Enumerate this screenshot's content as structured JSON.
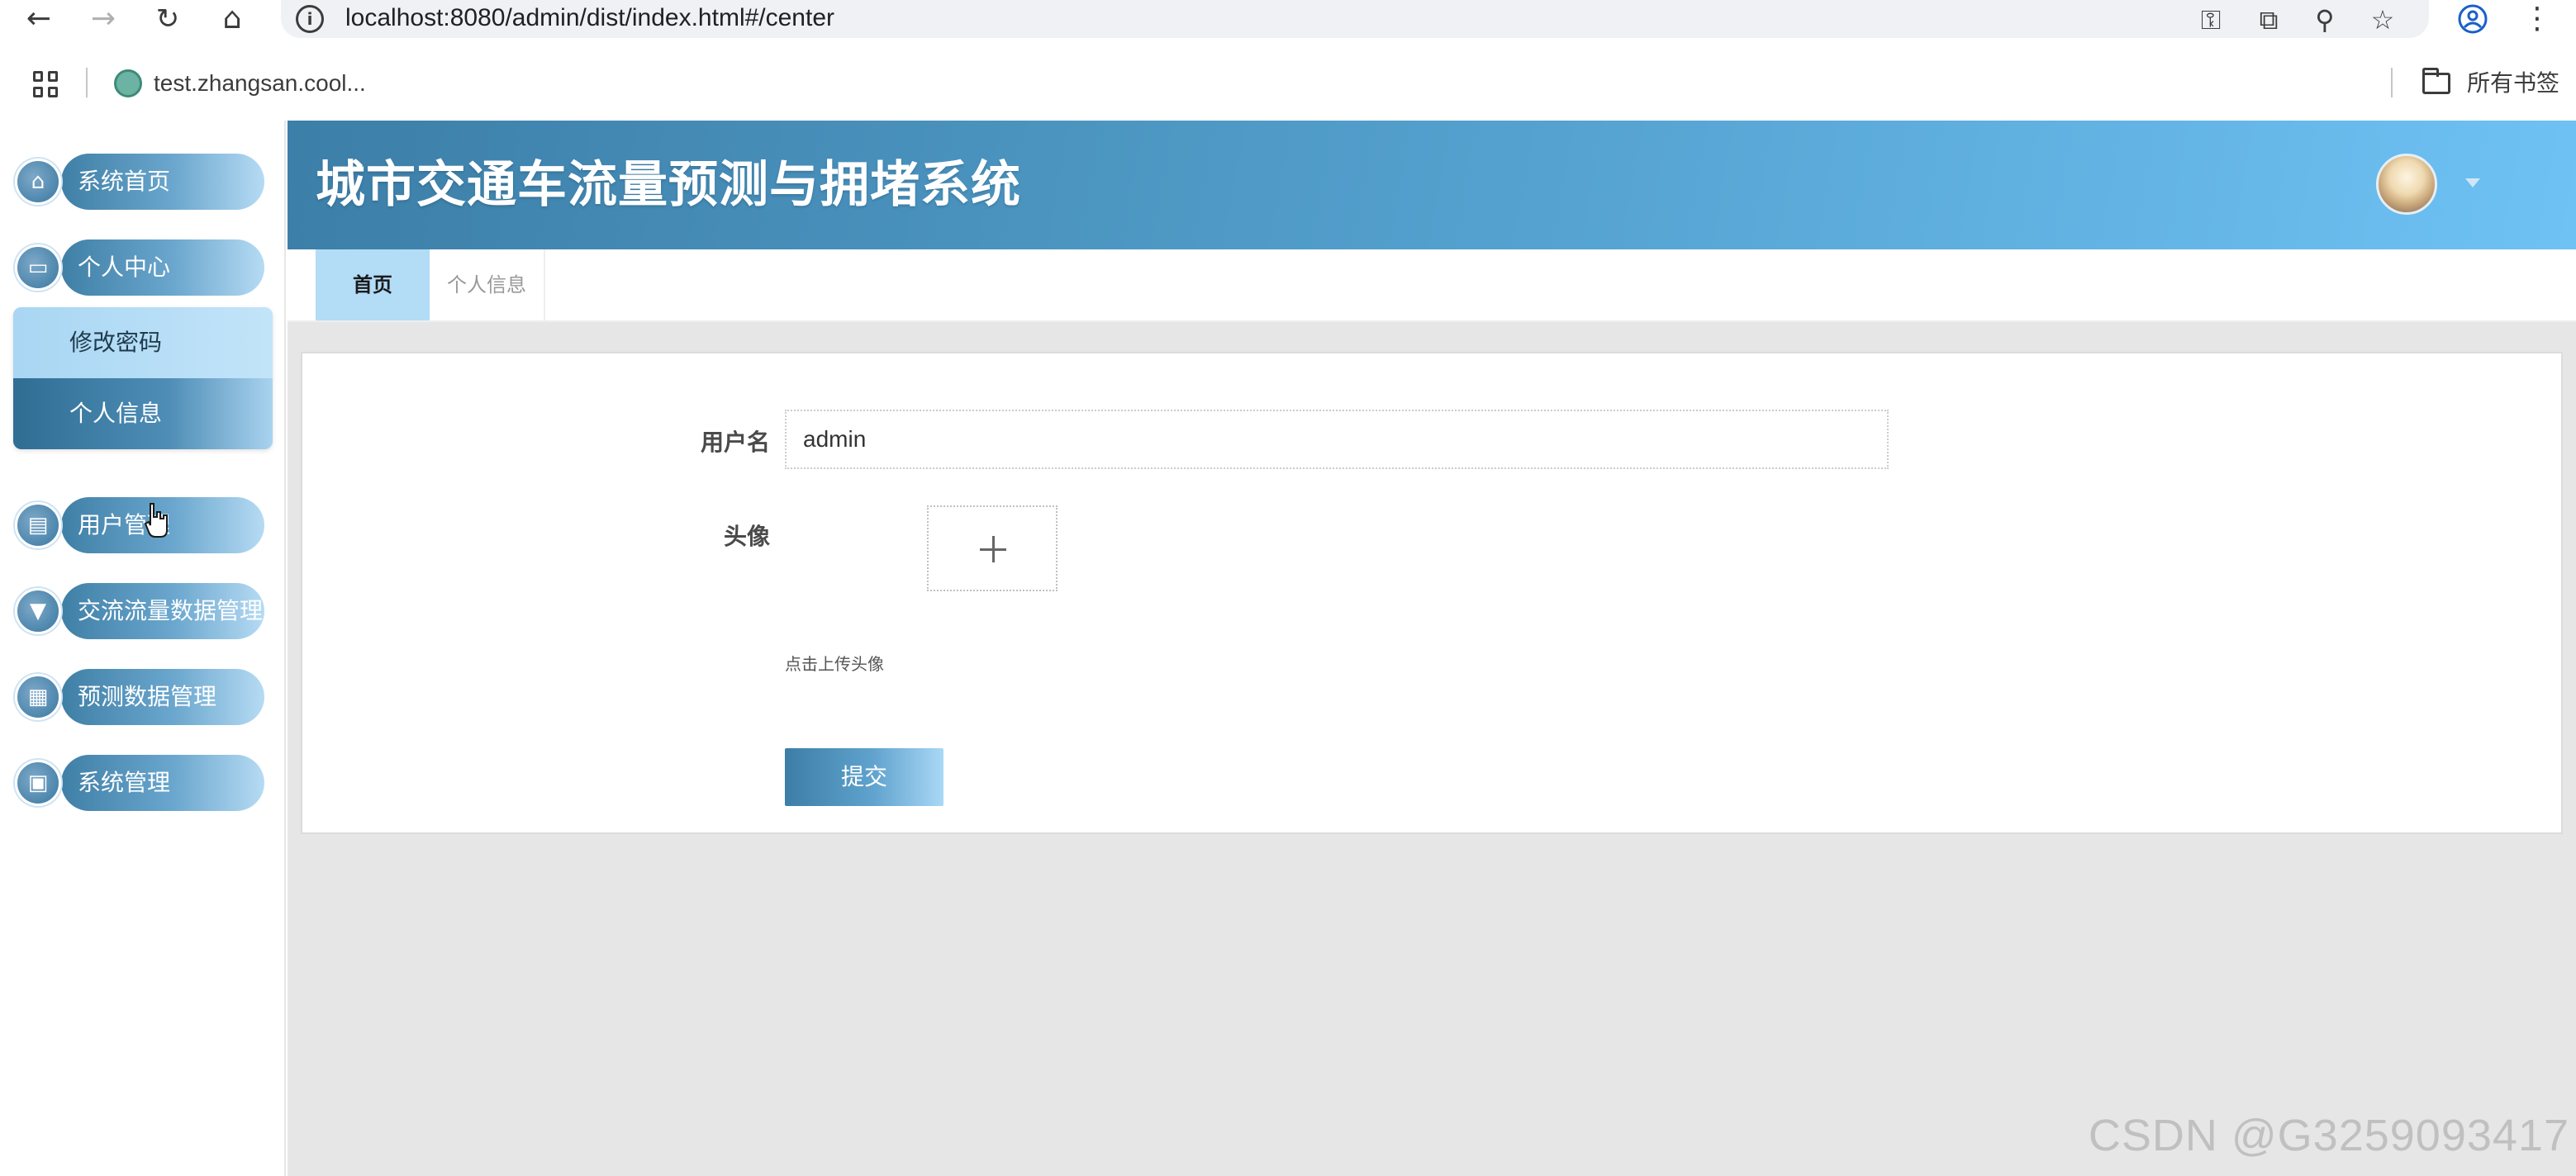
{
  "browser": {
    "url": "localhost:8080/admin/dist/index.html#/center",
    "bookmark_label": "test.zhangsan.cool...",
    "all_bookmarks_label": "所有书签"
  },
  "app": {
    "title": "城市交通车流量预测与拥堵系统"
  },
  "sidebar": {
    "items": [
      {
        "label": "系统首页",
        "icon": "home-icon"
      },
      {
        "label": "个人中心",
        "icon": "window-icon"
      },
      {
        "label": "用户管理",
        "icon": "clipboard-icon"
      },
      {
        "label": "交流流量数据管理",
        "icon": "pin-icon"
      },
      {
        "label": "预测数据管理",
        "icon": "grid-icon"
      },
      {
        "label": "系统管理",
        "icon": "briefcase-icon"
      }
    ],
    "submenu": [
      {
        "label": "修改密码"
      },
      {
        "label": "个人信息",
        "active": true
      }
    ]
  },
  "tabs": [
    {
      "label": "首页",
      "active": true
    },
    {
      "label": "个人信息",
      "active": false
    }
  ],
  "form": {
    "username_label": "用户名",
    "username_value": "admin",
    "avatar_label": "头像",
    "upload_hint": "点击上传头像",
    "submit_label": "提交"
  },
  "watermark": "CSDN @G3259093417",
  "colors": {
    "header_start": "#3c7fa8",
    "header_end": "#6ec2f4",
    "tab_active_bg": "#b3dcf6",
    "content_bg": "#e6e6e6"
  }
}
